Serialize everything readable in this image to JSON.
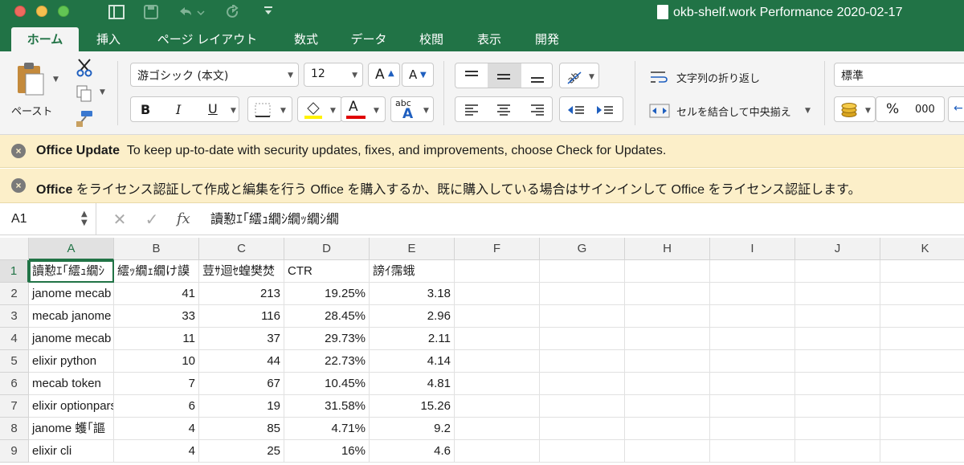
{
  "window": {
    "title": "okb-shelf.work Performance 2020-02-17"
  },
  "tabs": [
    "ホーム",
    "挿入",
    "ページ レイアウト",
    "数式",
    "データ",
    "校閲",
    "表示",
    "開発"
  ],
  "ribbon": {
    "paste_label": "ペースト",
    "font_name": "游ゴシック (本文)",
    "font_size": "12",
    "wrap_text_label": "文字列の折り返し",
    "merge_center_label": "セルを結合して中央揃え",
    "number_format": "標準",
    "bold": "B",
    "italic": "I",
    "underline": "U",
    "font_color_glyph": "A",
    "phonetic_glyph": "abc",
    "percent": "%",
    "thousands": "000",
    "grow_font": "A",
    "shrink_font": "A",
    "colors": {
      "highlight": "#fff200",
      "font_color": "#e00000"
    }
  },
  "banners": [
    {
      "title": "Office Update",
      "text": "To keep up-to-date with security updates, fixes, and improvements, choose Check for Updates."
    },
    {
      "title": "Office",
      "text": "をライセンス認証して作成と編集を行う  Office を購入するか、既に購入している場合はサインインして Office をライセンス認証します。"
    }
  ],
  "formula_bar": {
    "name_box": "A1",
    "cancel": "✕",
    "confirm": "✓",
    "fx": "fx",
    "content": "讀懃ｴ｢繧ｭ繝ｼ繝ｯ繝ｼ繝"
  },
  "columns": [
    "A",
    "B",
    "C",
    "D",
    "E",
    "F",
    "G",
    "H",
    "I",
    "J",
    "K"
  ],
  "rows": [
    [
      "讀懃ｴ｢繧ｭ繝ｼ",
      "繧ｯ繝ｪ繝け謨",
      "荳ｻ迴ｾ蝗樊焚",
      "CTR",
      "謗ｲ霈蛾",
      "",
      "",
      "",
      "",
      "",
      ""
    ],
    [
      "janome mecab",
      "41",
      "213",
      "19.25%",
      "3.18",
      "",
      "",
      "",
      "",
      "",
      ""
    ],
    [
      "mecab janome",
      "33",
      "116",
      "28.45%",
      "2.96",
      "",
      "",
      "",
      "",
      "",
      ""
    ],
    [
      "janome mecab",
      "11",
      "37",
      "29.73%",
      "2.11",
      "",
      "",
      "",
      "",
      "",
      ""
    ],
    [
      "elixir python",
      "10",
      "44",
      "22.73%",
      "4.14",
      "",
      "",
      "",
      "",
      "",
      ""
    ],
    [
      "mecab token",
      "7",
      "67",
      "10.45%",
      "4.81",
      "",
      "",
      "",
      "",
      "",
      ""
    ],
    [
      "elixir optionparser",
      "6",
      "19",
      "31.58%",
      "15.26",
      "",
      "",
      "",
      "",
      "",
      ""
    ],
    [
      "janome 蠖｢謳",
      "4",
      "85",
      "4.71%",
      "9.2",
      "",
      "",
      "",
      "",
      "",
      ""
    ],
    [
      "elixir cli",
      "4",
      "25",
      "16%",
      "4.6",
      "",
      "",
      "",
      "",
      "",
      ""
    ]
  ],
  "row_numbers": [
    "1",
    "2",
    "3",
    "4",
    "5",
    "6",
    "7",
    "8",
    "9"
  ],
  "numeric_columns_from_row": 2,
  "active_cell": "A1"
}
